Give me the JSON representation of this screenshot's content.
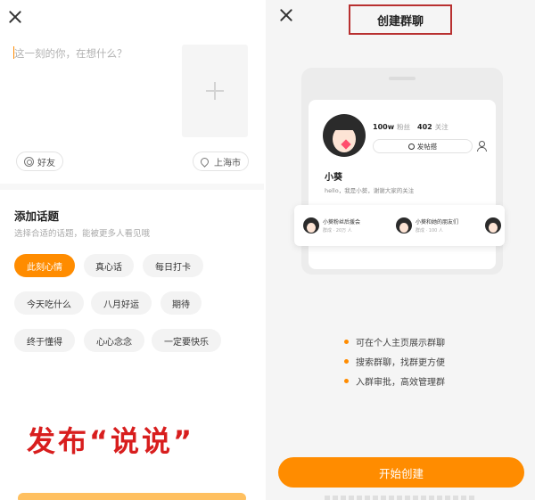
{
  "left": {
    "composer": {
      "placeholder": "这一刻的你，在想什么？"
    },
    "friends_label": "好友",
    "location_label": "上海市",
    "topics": {
      "title": "添加话题",
      "hint": "选择合适的话题，能被更多人看见哦",
      "tags": [
        {
          "label": "此刻心情",
          "active": true
        },
        {
          "label": "真心话",
          "active": false
        },
        {
          "label": "每日打卡",
          "active": false
        },
        {
          "label": "今天吃什么",
          "active": false
        },
        {
          "label": "八月好运",
          "active": false
        },
        {
          "label": "期待",
          "active": false
        },
        {
          "label": "终于懂得",
          "active": false
        },
        {
          "label": "心心念念",
          "active": false
        },
        {
          "label": "一定要快乐",
          "active": false
        }
      ]
    },
    "caption": "发布“说说”"
  },
  "right": {
    "title": "创建群聊",
    "preview": {
      "fans_count": "100w",
      "fans_label": "粉丝",
      "follow_count": "402",
      "follow_label": "关注",
      "post_label": "发帖搭",
      "username": "小葵",
      "bio": "hello，我是小葵，谢谢大家的关注",
      "groups": [
        {
          "name": "小葵粉丝后援会",
          "meta": "群成 · 20万 人"
        },
        {
          "name": "小葵和她的朋友们",
          "meta": "群成 · 100 人"
        }
      ]
    },
    "features": [
      "可在个人主页展示群聊",
      "搜索群聊，找群更方便",
      "入群审批，高效管理群"
    ],
    "start_button": "开始创建"
  },
  "colors": {
    "accent": "#ff8c00",
    "caption_red": "#d81e1e",
    "title_box_border": "#b83030"
  }
}
